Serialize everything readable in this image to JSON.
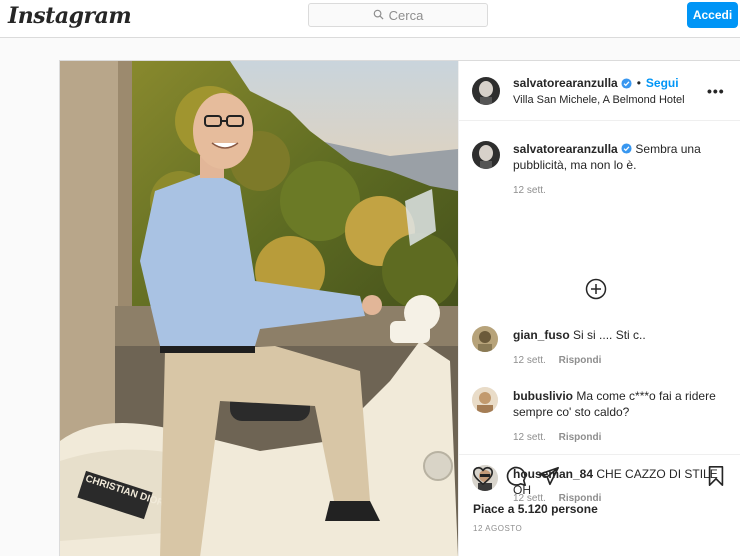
{
  "topbar": {
    "logo": "Instagram",
    "search_placeholder": "Cerca",
    "login_label": "Accedi"
  },
  "post": {
    "author": "salvatorearanzulla",
    "follow_label": "Segui",
    "separator": "•",
    "location": "Villa San Michele, A Belmond Hotel",
    "more_label": "•••",
    "comments": [
      {
        "user": "salvatorearanzulla",
        "text": "Sembra una pubblicità, ma non lo è.",
        "time": "12 sett.",
        "reply": ""
      },
      {
        "user": "gian_fuso",
        "text": "Si si .... Sti c..",
        "time": "12 sett.",
        "reply": "Rispondi"
      },
      {
        "user": "bubuslivio",
        "text": "Ma come c***o fai a ridere sempre co' sto caldo?",
        "time": "12 sett.",
        "reply": "Rispondi"
      },
      {
        "user": "houseman_84",
        "text": "CHE CAZZO DI STILE OH",
        "time": "12 sett.",
        "reply": "Rispondi"
      }
    ],
    "likes": "Piace a 5.120 persone",
    "date": "12 AGOSTO",
    "photo_vespa_lettering": "CHRISTIAN DIOR",
    "icons": [
      "heart-icon",
      "comment-icon",
      "share-icon",
      "bookmark-icon",
      "plus-circle-icon",
      "verified-icon",
      "search-icon"
    ],
    "accent_color": "#0095f6"
  }
}
